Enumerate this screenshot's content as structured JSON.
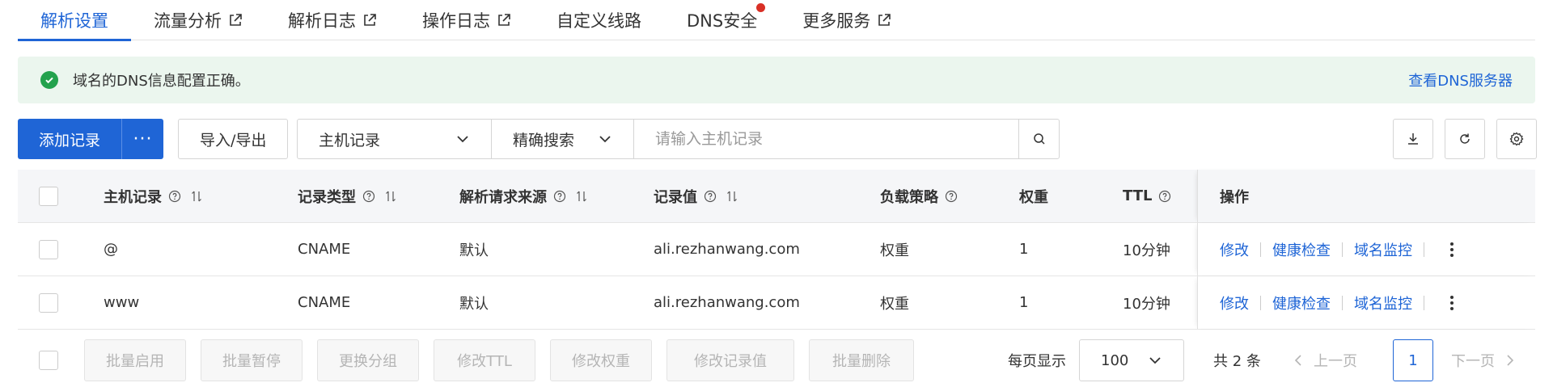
{
  "tabs": [
    {
      "label": "解析设置",
      "active": true,
      "external": false,
      "badge": false
    },
    {
      "label": "流量分析",
      "active": false,
      "external": true,
      "badge": false
    },
    {
      "label": "解析日志",
      "active": false,
      "external": true,
      "badge": false
    },
    {
      "label": "操作日志",
      "active": false,
      "external": true,
      "badge": false
    },
    {
      "label": "自定义线路",
      "active": false,
      "external": false,
      "badge": false
    },
    {
      "label": "DNS安全",
      "active": false,
      "external": false,
      "badge": true
    },
    {
      "label": "更多服务",
      "active": false,
      "external": true,
      "badge": false
    }
  ],
  "alert": {
    "icon": "check-circle-icon",
    "message": "域名的DNS信息配置正确。",
    "link": "查看DNS服务器"
  },
  "toolbar": {
    "add_label": "添加记录",
    "more_label": "···",
    "import_export_label": "导入/导出",
    "field_select": "主机记录",
    "match_select": "精确搜索",
    "search_placeholder": "请输入主机记录",
    "icons": [
      "download-icon",
      "refresh-icon",
      "settings-icon"
    ]
  },
  "table": {
    "columns": {
      "host": "主机记录",
      "type": "记录类型",
      "source": "解析请求来源",
      "value": "记录值",
      "strategy": "负载策略",
      "weight": "权重",
      "ttl": "TTL",
      "actions": "操作"
    },
    "rows": [
      {
        "host": "@",
        "type": "CNAME",
        "source": "默认",
        "value": "ali.rezhanwang.com",
        "strategy": "权重",
        "weight": "1",
        "ttl": "10分钟"
      },
      {
        "host": "www",
        "type": "CNAME",
        "source": "默认",
        "value": "ali.rezhanwang.com",
        "strategy": "权重",
        "weight": "1",
        "ttl": "10分钟"
      }
    ],
    "row_actions": {
      "edit": "修改",
      "health": "健康检查",
      "monitor": "域名监控"
    }
  },
  "footer": {
    "batch_buttons": [
      "批量启用",
      "批量暂停",
      "更换分组",
      "修改TTL",
      "修改权重",
      "修改记录值",
      "批量删除"
    ],
    "page_size_label": "每页显示",
    "page_size": "100",
    "total": "共 2 条",
    "prev": "上一页",
    "current_page": "1",
    "next": "下一页"
  },
  "colors": {
    "primary": "#1f65d6",
    "success": "#23a24d",
    "alert_bg": "#ebf6ee",
    "badge": "#d93026"
  }
}
